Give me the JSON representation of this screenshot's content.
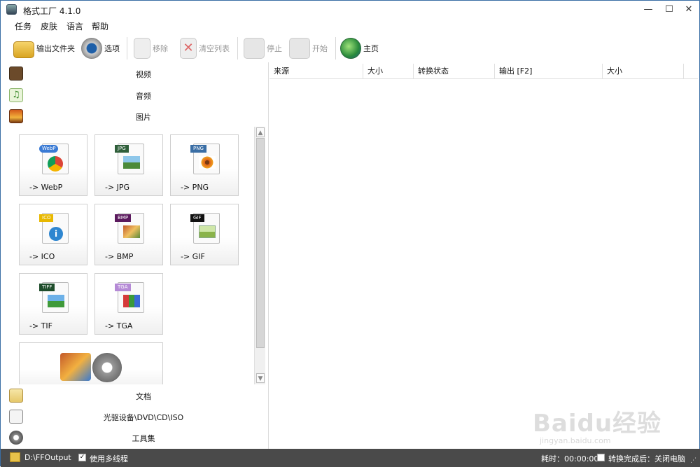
{
  "window": {
    "title": "格式工厂 4.1.0"
  },
  "menu": [
    "任务",
    "皮肤",
    "语言",
    "帮助"
  ],
  "toolbar": {
    "output_folder": "输出文件夹",
    "options": "选项",
    "remove": "移除",
    "clear_list": "清空列表",
    "stop": "停止",
    "start": "开始",
    "home": "主页"
  },
  "categories": {
    "video": "视频",
    "audio": "音频",
    "picture": "图片",
    "document": "文档",
    "optical": "光驱设备\\DVD\\CD\\ISO",
    "tools": "工具集"
  },
  "tiles": [
    {
      "label": "-> WebP",
      "tag": "WebP",
      "tag_color": "#3a7bd5"
    },
    {
      "label": "-> JPG",
      "tag": "JPG",
      "tag_color": "#2f5f3a"
    },
    {
      "label": "-> PNG",
      "tag": "PNG",
      "tag_color": "#3a6ea5"
    },
    {
      "label": "-> ICO",
      "tag": "ICO",
      "tag_color": "#e8b800"
    },
    {
      "label": "-> BMP",
      "tag": "BMP",
      "tag_color": "#5b1a5e"
    },
    {
      "label": "-> GIF",
      "tag": "GIF",
      "tag_color": "#111111"
    },
    {
      "label": "-> TIF",
      "tag": "TIFF",
      "tag_color": "#1e4d2b"
    },
    {
      "label": "-> TGA",
      "tag": "TGA",
      "tag_color": "#b58ad6"
    }
  ],
  "table": {
    "columns": [
      "来源",
      "大小",
      "转换状态",
      "输出 [F2]",
      "大小"
    ]
  },
  "status": {
    "output_path": "D:\\FFOutput",
    "multithread": "使用多线程",
    "elapsed": "耗时：00:00:00",
    "after_convert": "转换完成后：关闭电脑"
  },
  "watermark": {
    "brand": "Baidu经验",
    "url": "jingyan.baidu.com"
  }
}
